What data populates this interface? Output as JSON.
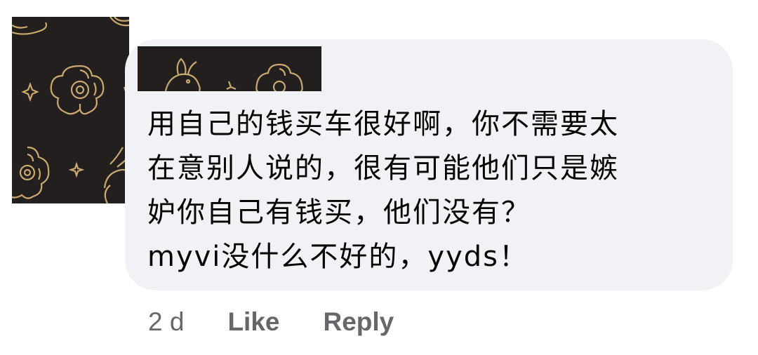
{
  "comment": {
    "avatar_icon": "rabbit-mooncake-pattern",
    "name_redacted": true,
    "lines": [
      "用自己的钱买车很好啊，你不需要太",
      "在意别人说的，很有可能他们只是嫉",
      "妒你自己有钱买，他们没有？",
      "myvi没什么不好的，yyds！"
    ],
    "bubble_color": "#f0f2f5",
    "pattern_color": "#231f1f",
    "gold_color": "#c9a96e"
  },
  "actions": {
    "timestamp": "2 d",
    "like_label": "Like",
    "reply_label": "Reply"
  }
}
